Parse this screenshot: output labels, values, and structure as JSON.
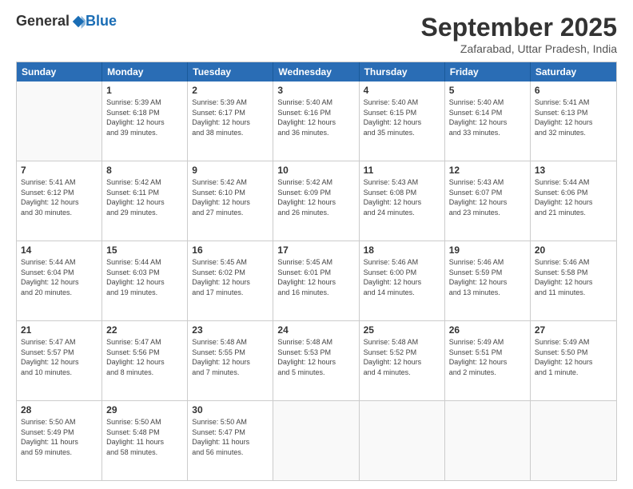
{
  "logo": {
    "general": "General",
    "blue": "Blue"
  },
  "title": "September 2025",
  "location": "Zafarabad, Uttar Pradesh, India",
  "header_days": [
    "Sunday",
    "Monday",
    "Tuesday",
    "Wednesday",
    "Thursday",
    "Friday",
    "Saturday"
  ],
  "weeks": [
    [
      {
        "day": "",
        "info": ""
      },
      {
        "day": "1",
        "info": "Sunrise: 5:39 AM\nSunset: 6:18 PM\nDaylight: 12 hours\nand 39 minutes."
      },
      {
        "day": "2",
        "info": "Sunrise: 5:39 AM\nSunset: 6:17 PM\nDaylight: 12 hours\nand 38 minutes."
      },
      {
        "day": "3",
        "info": "Sunrise: 5:40 AM\nSunset: 6:16 PM\nDaylight: 12 hours\nand 36 minutes."
      },
      {
        "day": "4",
        "info": "Sunrise: 5:40 AM\nSunset: 6:15 PM\nDaylight: 12 hours\nand 35 minutes."
      },
      {
        "day": "5",
        "info": "Sunrise: 5:40 AM\nSunset: 6:14 PM\nDaylight: 12 hours\nand 33 minutes."
      },
      {
        "day": "6",
        "info": "Sunrise: 5:41 AM\nSunset: 6:13 PM\nDaylight: 12 hours\nand 32 minutes."
      }
    ],
    [
      {
        "day": "7",
        "info": "Sunrise: 5:41 AM\nSunset: 6:12 PM\nDaylight: 12 hours\nand 30 minutes."
      },
      {
        "day": "8",
        "info": "Sunrise: 5:42 AM\nSunset: 6:11 PM\nDaylight: 12 hours\nand 29 minutes."
      },
      {
        "day": "9",
        "info": "Sunrise: 5:42 AM\nSunset: 6:10 PM\nDaylight: 12 hours\nand 27 minutes."
      },
      {
        "day": "10",
        "info": "Sunrise: 5:42 AM\nSunset: 6:09 PM\nDaylight: 12 hours\nand 26 minutes."
      },
      {
        "day": "11",
        "info": "Sunrise: 5:43 AM\nSunset: 6:08 PM\nDaylight: 12 hours\nand 24 minutes."
      },
      {
        "day": "12",
        "info": "Sunrise: 5:43 AM\nSunset: 6:07 PM\nDaylight: 12 hours\nand 23 minutes."
      },
      {
        "day": "13",
        "info": "Sunrise: 5:44 AM\nSunset: 6:06 PM\nDaylight: 12 hours\nand 21 minutes."
      }
    ],
    [
      {
        "day": "14",
        "info": "Sunrise: 5:44 AM\nSunset: 6:04 PM\nDaylight: 12 hours\nand 20 minutes."
      },
      {
        "day": "15",
        "info": "Sunrise: 5:44 AM\nSunset: 6:03 PM\nDaylight: 12 hours\nand 19 minutes."
      },
      {
        "day": "16",
        "info": "Sunrise: 5:45 AM\nSunset: 6:02 PM\nDaylight: 12 hours\nand 17 minutes."
      },
      {
        "day": "17",
        "info": "Sunrise: 5:45 AM\nSunset: 6:01 PM\nDaylight: 12 hours\nand 16 minutes."
      },
      {
        "day": "18",
        "info": "Sunrise: 5:46 AM\nSunset: 6:00 PM\nDaylight: 12 hours\nand 14 minutes."
      },
      {
        "day": "19",
        "info": "Sunrise: 5:46 AM\nSunset: 5:59 PM\nDaylight: 12 hours\nand 13 minutes."
      },
      {
        "day": "20",
        "info": "Sunrise: 5:46 AM\nSunset: 5:58 PM\nDaylight: 12 hours\nand 11 minutes."
      }
    ],
    [
      {
        "day": "21",
        "info": "Sunrise: 5:47 AM\nSunset: 5:57 PM\nDaylight: 12 hours\nand 10 minutes."
      },
      {
        "day": "22",
        "info": "Sunrise: 5:47 AM\nSunset: 5:56 PM\nDaylight: 12 hours\nand 8 minutes."
      },
      {
        "day": "23",
        "info": "Sunrise: 5:48 AM\nSunset: 5:55 PM\nDaylight: 12 hours\nand 7 minutes."
      },
      {
        "day": "24",
        "info": "Sunrise: 5:48 AM\nSunset: 5:53 PM\nDaylight: 12 hours\nand 5 minutes."
      },
      {
        "day": "25",
        "info": "Sunrise: 5:48 AM\nSunset: 5:52 PM\nDaylight: 12 hours\nand 4 minutes."
      },
      {
        "day": "26",
        "info": "Sunrise: 5:49 AM\nSunset: 5:51 PM\nDaylight: 12 hours\nand 2 minutes."
      },
      {
        "day": "27",
        "info": "Sunrise: 5:49 AM\nSunset: 5:50 PM\nDaylight: 12 hours\nand 1 minute."
      }
    ],
    [
      {
        "day": "28",
        "info": "Sunrise: 5:50 AM\nSunset: 5:49 PM\nDaylight: 11 hours\nand 59 minutes."
      },
      {
        "day": "29",
        "info": "Sunrise: 5:50 AM\nSunset: 5:48 PM\nDaylight: 11 hours\nand 58 minutes."
      },
      {
        "day": "30",
        "info": "Sunrise: 5:50 AM\nSunset: 5:47 PM\nDaylight: 11 hours\nand 56 minutes."
      },
      {
        "day": "",
        "info": ""
      },
      {
        "day": "",
        "info": ""
      },
      {
        "day": "",
        "info": ""
      },
      {
        "day": "",
        "info": ""
      }
    ]
  ]
}
